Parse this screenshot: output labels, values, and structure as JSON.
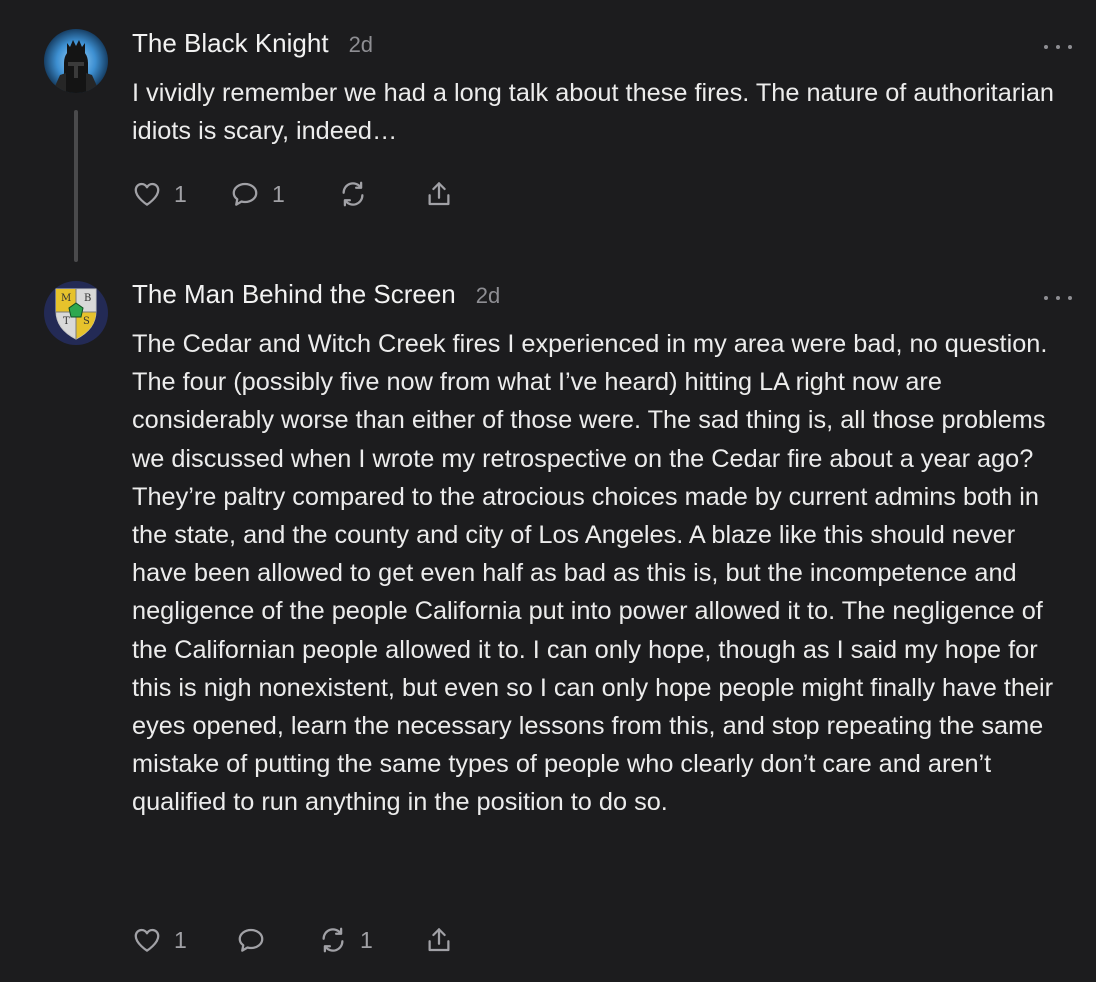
{
  "comments": [
    {
      "author": "The Black Knight",
      "time": "2d",
      "text": "I vividly remember we had a long talk about these fires. The nature of authoritarian idiots is scary, indeed…",
      "avatar_icon": "dark-knight-helmet-avatar",
      "likes": "1",
      "replies": "1",
      "restacks": ""
    },
    {
      "author": "The Man Behind the Screen",
      "time": "2d",
      "text": "The Cedar and Witch Creek fires I experienced in my area were bad, no question. The four (possibly five now from what I’ve heard) hitting LA right now are considerably worse than either of those were. The sad thing is, all those problems we discussed when I wrote my retrospective on the Cedar fire about a year ago? They’re paltry compared to the atrocious choices made by current admins both in the state, and the county and city of Los Angeles. A blaze like this should never have been allowed to get even half as bad as this is, but the incompetence and negligence of the people California put into power allowed it to. The negligence of the Californian people allowed it to. I can only hope, though as I said my hope for this is nigh nonexistent, but even so I can only hope people might finally have their eyes opened, learn the necessary lessons from this, and stop repeating the same mistake of putting the same types of people who clearly don’t care and aren’t qualified to run anything in the position to do so.",
      "avatar_icon": "shield-crest-avatar",
      "avatar_letters": [
        "M",
        "B",
        "T",
        "S"
      ],
      "likes": "1",
      "replies": "",
      "restacks": "1"
    }
  ],
  "colors": {
    "background": "#1c1c1e",
    "text": "#ececec",
    "muted": "#8e8e93",
    "icon": "#a1a1a6",
    "thread_line": "#4a4a4c"
  }
}
